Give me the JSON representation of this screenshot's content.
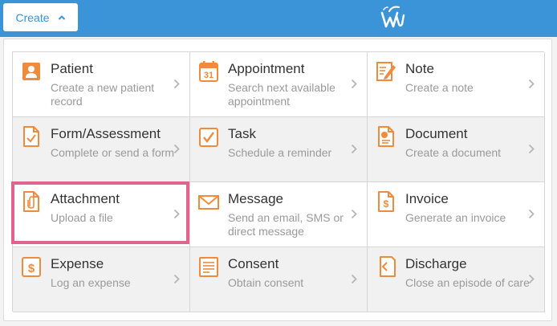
{
  "header": {
    "create_label": "Create",
    "background_color": "#3b93d8",
    "logo_icon": "wu-logo-icon"
  },
  "menu": {
    "accent_color": "#f08a3c",
    "highlight_color": "#e0648e",
    "items": [
      {
        "title": "Patient",
        "desc": "Create a new patient record",
        "icon": "patient-icon"
      },
      {
        "title": "Appointment",
        "desc": "Search next available appointment",
        "icon": "calendar-icon",
        "icon_text": "31"
      },
      {
        "title": "Note",
        "desc": "Create a note",
        "icon": "note-icon"
      },
      {
        "title": "Form/Assessment",
        "desc": "Complete or send a form",
        "icon": "form-icon"
      },
      {
        "title": "Task",
        "desc": "Schedule a reminder",
        "icon": "task-checkbox-icon"
      },
      {
        "title": "Document",
        "desc": "Create a document",
        "icon": "document-icon"
      },
      {
        "title": "Attachment",
        "desc": "Upload a file",
        "icon": "paperclip-icon"
      },
      {
        "title": "Message",
        "desc": "Send an email, SMS or direct message",
        "icon": "envelope-icon"
      },
      {
        "title": "Invoice",
        "desc": "Generate an invoice",
        "icon": "invoice-icon"
      },
      {
        "title": "Expense",
        "desc": "Log an expense",
        "icon": "expense-icon"
      },
      {
        "title": "Consent",
        "desc": "Obtain consent",
        "icon": "consent-icon"
      },
      {
        "title": "Discharge",
        "desc": "Close an episode of care",
        "icon": "discharge-icon"
      }
    ]
  }
}
